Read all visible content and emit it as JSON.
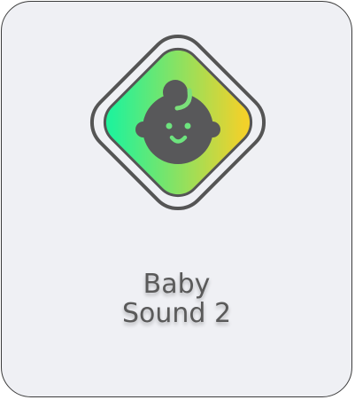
{
  "tile": {
    "label_line1": "Baby",
    "label_line2": "Sound 2",
    "icon": "baby-face-icon",
    "colors": {
      "gradient_start": "#22f29a",
      "gradient_end": "#f2d12a",
      "outline": "#555555",
      "background": "#eff0f4",
      "text": "#5a5a5a"
    }
  }
}
